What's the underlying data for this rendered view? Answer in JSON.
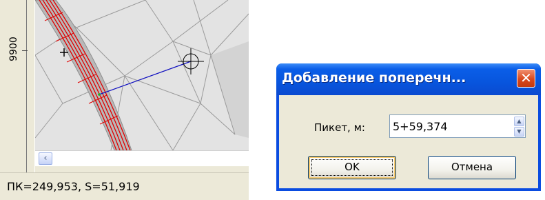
{
  "cad": {
    "ruler_label": "9900",
    "status_text": "ПК=249,953,  S=51,919",
    "scroll_left_icon": "‹"
  },
  "dialog": {
    "title": "Добавление поперечн...",
    "close_icon": "✕",
    "picket_label": "Пикет, м:",
    "picket_value": "5+59,374",
    "spin_up_icon": "▲",
    "spin_down_icon": "▼",
    "ok_label": "OK",
    "cancel_label": "Отмена"
  },
  "colors": {
    "titlebar": "#0855dd",
    "close_button": "#d9481d",
    "road_lines": "#e00000",
    "section_line": "#1010c0"
  }
}
